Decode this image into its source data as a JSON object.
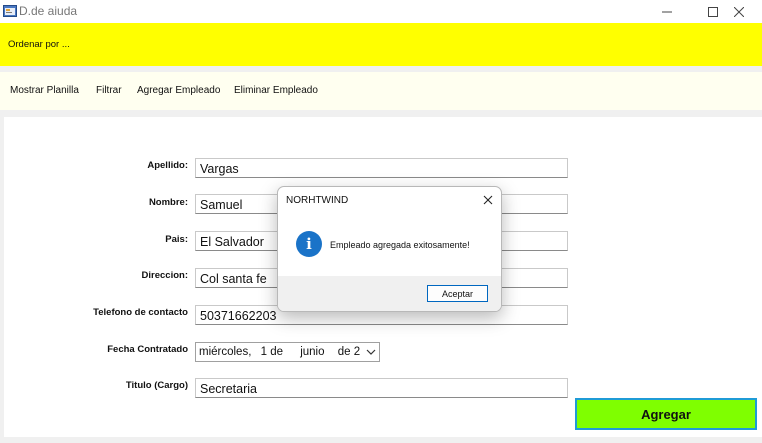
{
  "window": {
    "title": "D.de aiuda",
    "icon": "app-form-icon",
    "controls": {
      "minimize": "minimize-icon",
      "maximize": "maximize-icon",
      "close": "close-icon"
    }
  },
  "header_bar": {
    "text": "Ordenar por ...",
    "color": "#ffff00"
  },
  "menu": [
    {
      "label": "Mostrar  Planilla"
    },
    {
      "label": "Filtrar"
    },
    {
      "label": "Agregar Empleado"
    },
    {
      "label": "Eliminar Empleado"
    }
  ],
  "form": {
    "fields": [
      {
        "label": "Apellido:",
        "value": "Vargas"
      },
      {
        "label": "Nombre:",
        "value": "Samuel"
      },
      {
        "label": "Pais:",
        "value": "El Salvador"
      },
      {
        "label": "Direccion:",
        "value": "Col santa fe"
      },
      {
        "label": "Telefono de contacto",
        "value": "50371662203"
      }
    ],
    "date": {
      "label": "Fecha Contratado",
      "weekday": "miércoles,",
      "day": "1 de",
      "month": "junio",
      "year_part": "de 2"
    },
    "title_field": {
      "label": "Titulo (Cargo)",
      "value": "Secretaria"
    },
    "submit_label": "Agregar",
    "submit_color": "#7fff00"
  },
  "dialog": {
    "title": "NORHTWIND",
    "icon": "info-icon",
    "icon_glyph": "i",
    "message": "Empleado agregada exitosamente!",
    "ok_label": "Aceptar",
    "accent": "#1a73c8"
  }
}
